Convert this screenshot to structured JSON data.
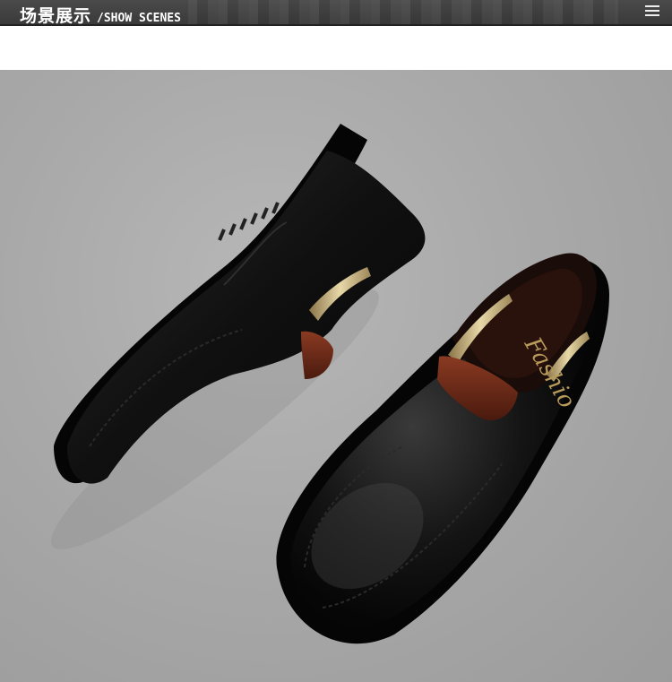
{
  "header": {
    "title_cn": "场景展示",
    "title_en": "/SHOW SCENES"
  },
  "photo": {
    "insole_text": "Fashio",
    "colors": {
      "background": "#a8a8a8",
      "leather": "#0c0c0c",
      "heel_tab": "#6b2a1a",
      "gold_trim": "#c9b37a"
    }
  }
}
